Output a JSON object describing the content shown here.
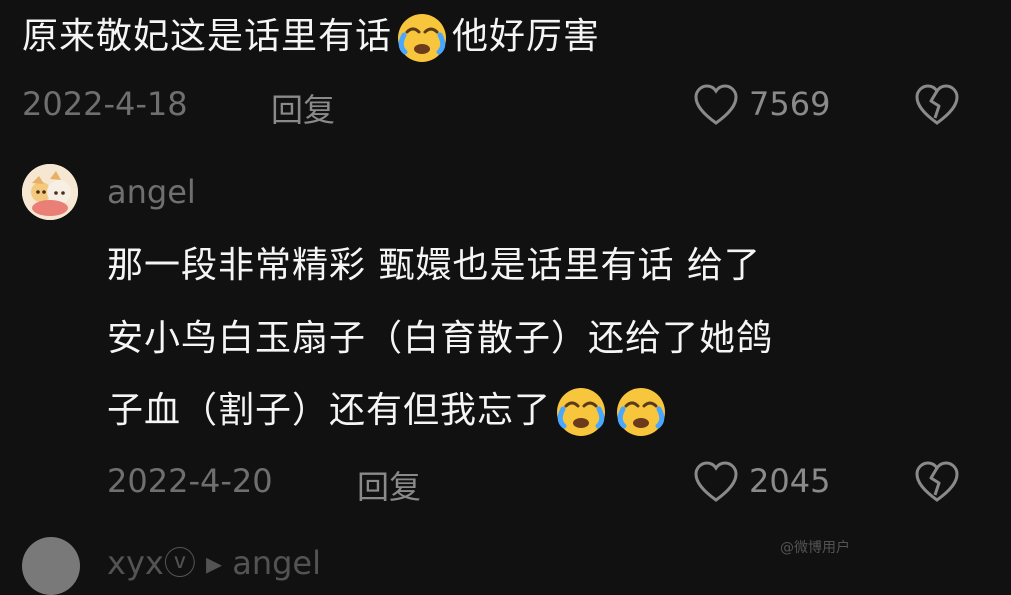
{
  "comment_1": {
    "text_before_emoji": "原来敬妃这是话里有话",
    "emoji_name": "crying-laughing-face",
    "text_after_emoji": "他好厉害",
    "date": "2022-4-18",
    "reply_label": "回复",
    "like_count": "7569"
  },
  "reply_1": {
    "username": "angel",
    "line_1": "那一段非常精彩 甄嬛也是话里有话 给了",
    "line_2": "安小鸟白玉扇子（白育散子）还给了她鸽",
    "line_3_text": "子血（割子）还有但我忘了",
    "emoji_name": "crying-laughing-face",
    "date": "2022-4-20",
    "reply_label": "回复",
    "like_count": "2045"
  },
  "next_item": {
    "label": "xyxⓥ ▸ angel"
  },
  "watermark": {
    "text": "@微博用户"
  }
}
